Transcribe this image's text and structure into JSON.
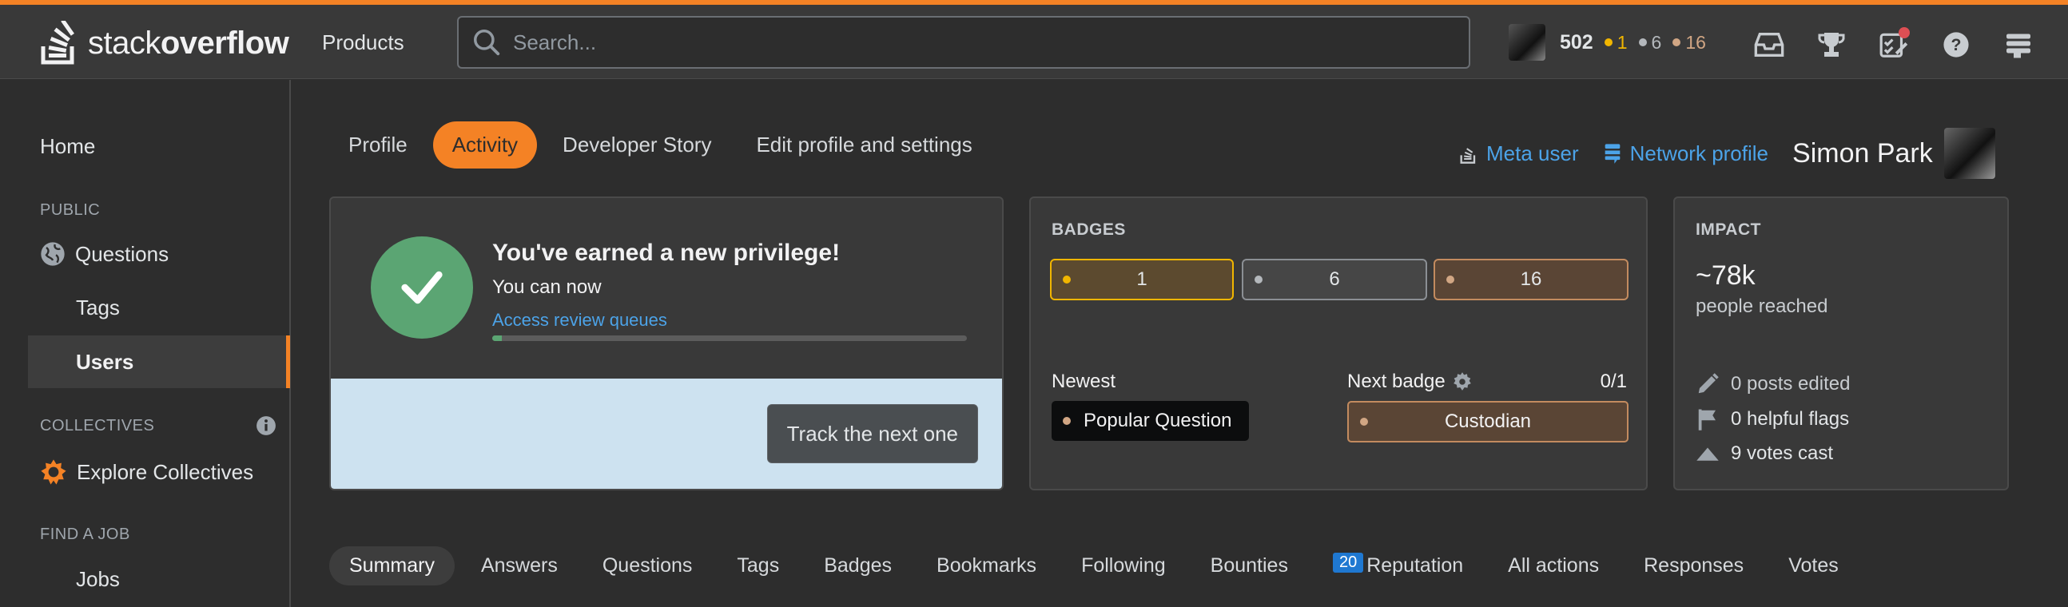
{
  "topbar": {
    "logo_light": "stack",
    "logo_bold": "overflow",
    "products": "Products",
    "search_placeholder": "Search...",
    "reputation": "502",
    "gold": "1",
    "silver": "6",
    "bronze": "16"
  },
  "sidebar": {
    "home": "Home",
    "public": "PUBLIC",
    "questions": "Questions",
    "tags": "Tags",
    "users": "Users",
    "collectives": "COLLECTIVES",
    "explore": "Explore Collectives",
    "find_job": "FIND A JOB",
    "jobs": "Jobs"
  },
  "profile_tabs": [
    "Profile",
    "Activity",
    "Developer Story",
    "Edit profile and settings"
  ],
  "header": {
    "meta_user": "Meta user",
    "network_profile": "Network profile",
    "user_name": "Simon Park"
  },
  "privilege": {
    "title": "You've earned a new privilege!",
    "subtitle": "You can now",
    "link": "Access review queues",
    "progress": 0.02,
    "button": "Track the next one"
  },
  "badges": {
    "label": "BADGES",
    "gold": "1",
    "silver": "6",
    "bronze": "16",
    "newest_label": "Newest",
    "newest_badge": "Popular Question",
    "next_label": "Next badge",
    "next_count": "0/1",
    "next_badge": "Custodian"
  },
  "impact": {
    "label": "IMPACT",
    "reached": "~78k",
    "reached_label": "people reached",
    "posts_edited": "0 posts edited",
    "helpful_flags": "0 helpful flags",
    "votes_cast": "9 votes cast"
  },
  "activity_tabs": {
    "summary": "Summary",
    "answers": "Answers",
    "questions": "Questions",
    "tags": "Tags",
    "badges": "Badges",
    "bookmarks": "Bookmarks",
    "following": "Following",
    "bounties": "Bounties",
    "rep_count": "20",
    "reputation": "Reputation",
    "all_actions": "All actions",
    "responses": "Responses",
    "votes": "Votes"
  },
  "colors": {
    "accent": "#f48225",
    "link": "#4ca3e8",
    "gold": "#f1b600",
    "silver": "#b4b8bc",
    "bronze": "#d1a684"
  }
}
